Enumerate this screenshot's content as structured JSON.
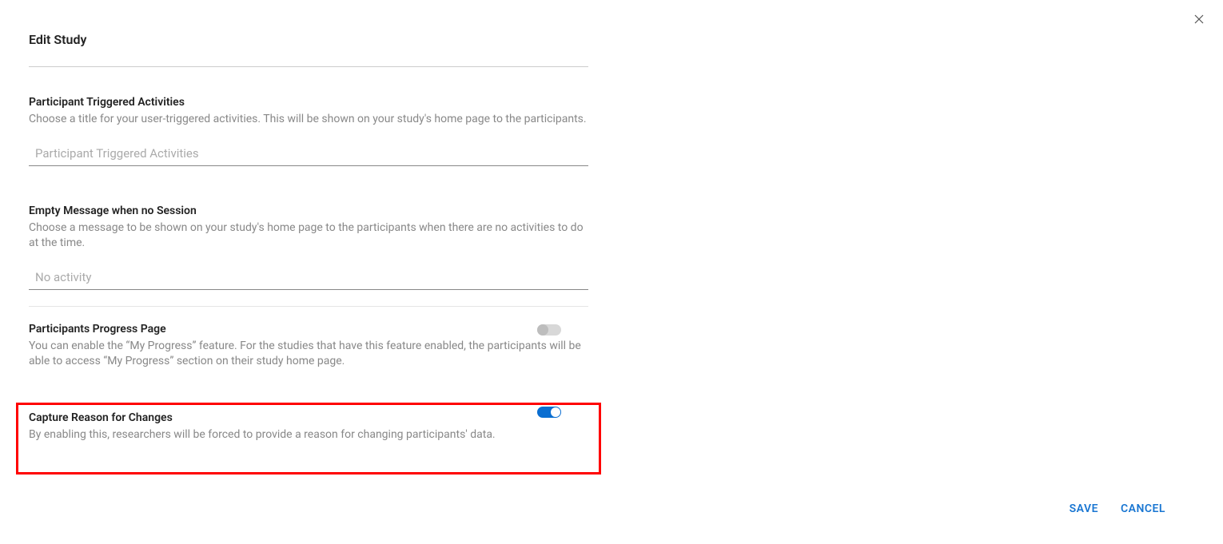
{
  "title": "Edit Study",
  "sections": {
    "triggered": {
      "label": "Participant Triggered Activities",
      "desc": "Choose a title for your user-triggered activities. This will be shown on your study's home page to the participants.",
      "placeholder": "Participant Triggered Activities",
      "value": ""
    },
    "empty_message": {
      "label": "Empty Message when no Session",
      "desc": "Choose a message to be shown on your study's home page to the participants when there are no activities to do at the time.",
      "placeholder": "No activity",
      "value": ""
    },
    "progress": {
      "label": "Participants Progress Page",
      "desc": "You can enable the “My Progress” feature. For the studies that have this feature enabled, the participants will be able to access “My Progress” section on their study home page.",
      "toggle": false
    },
    "capture": {
      "label": "Capture Reason for Changes",
      "desc": "By enabling this, researchers will be forced to provide a reason for changing participants' data.",
      "toggle": true
    }
  },
  "footer": {
    "save": "SAVE",
    "cancel": "CANCEL"
  }
}
